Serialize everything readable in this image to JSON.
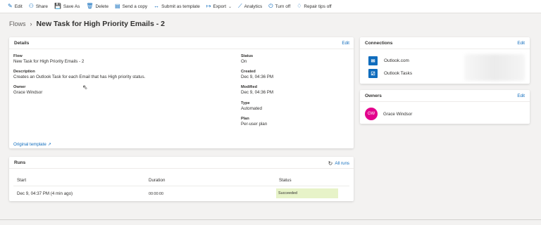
{
  "toolbar": [
    {
      "label": "Edit",
      "icon": "✎"
    },
    {
      "label": "Share",
      "icon": "⚇"
    },
    {
      "label": "Save As",
      "icon": "💾"
    },
    {
      "label": "Delete",
      "icon": "🗑"
    },
    {
      "label": "Send a copy",
      "icon": "▤"
    },
    {
      "label": "Submit as template",
      "icon": "↔"
    },
    {
      "label": "Export",
      "icon": "↦"
    },
    {
      "label": "Analytics",
      "icon": "⟋"
    },
    {
      "label": "Turn off",
      "icon": "⏻"
    },
    {
      "label": "Repair tips off",
      "icon": "♢"
    }
  ],
  "breadcrumb": {
    "root": "Flows",
    "separator": "›",
    "title": "New Task for High Priority Emails - 2"
  },
  "details": {
    "heading": "Details",
    "edit_label": "Edit",
    "flow_label": "Flow",
    "flow_value": "New Task for High Priority Emails - 2",
    "description_label": "Description",
    "description_value": "Creates an Outlook Task for each Email that has High priority status.",
    "owner_label": "Owner",
    "owner_value": "Grace Windsor",
    "status_label": "Status",
    "status_value": "On",
    "created_label": "Created",
    "created_value": "Dec 9, 04:36 PM",
    "modified_label": "Modified",
    "modified_value": "Dec 9, 04:36 PM",
    "type_label": "Type",
    "type_value": "Automated",
    "plan_label": "Plan",
    "plan_value": "Per-user plan",
    "original_template": "Original template"
  },
  "runs": {
    "heading": "Runs",
    "all_runs": "All runs",
    "columns": [
      "Start",
      "Duration",
      "Status"
    ],
    "rows": [
      {
        "start": "Dec 9, 04:37 PM (4 min ago)",
        "duration": "00:00:00",
        "status": "Succeeded"
      }
    ]
  },
  "connections": {
    "heading": "Connections",
    "edit_label": "Edit",
    "items": [
      {
        "name": "Outlook.com",
        "icon": "outlook-icon"
      },
      {
        "name": "Outlook Tasks",
        "icon": "tasks-icon"
      }
    ]
  },
  "owners": {
    "heading": "Owners",
    "edit_label": "Edit",
    "items": [
      {
        "initials": "GW",
        "name": "Grace Windsor"
      }
    ]
  },
  "colors": {
    "accent": "#0f6cbd",
    "avatar": "#e3008c",
    "success_bg": "#e7f3c8"
  }
}
